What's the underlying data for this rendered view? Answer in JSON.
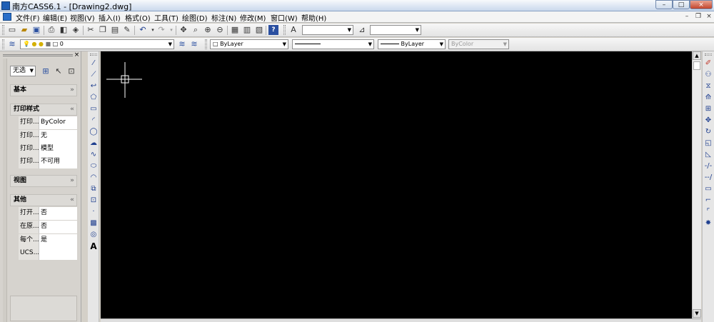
{
  "titlebar": {
    "app_title": "南方CASS6.1 - [Drawing2.dwg]",
    "min": "–",
    "max": "□",
    "close": "×"
  },
  "menubar": {
    "items": [
      "文件(F)",
      "编辑(E)",
      "视图(V)",
      "插入(I)",
      "格式(O)",
      "工具(T)",
      "绘图(D)",
      "标注(N)",
      "修改(M)",
      "窗口(W)",
      "帮助(H)"
    ],
    "mdi_min": "–",
    "mdi_restore": "❐",
    "mdi_close": "×"
  },
  "layer_toolbar": {
    "layer_value": "0",
    "color_value": "ByLayer",
    "linetype_value": "ByLayer",
    "lineweight_value": "",
    "plotstyle_value": "ByColor"
  },
  "palette": {
    "close": "×",
    "selection_value": "无选",
    "sections": {
      "basic": "基本",
      "plot_style": "打印样式",
      "view": "视图",
      "misc": "其他"
    },
    "plot_rows": [
      {
        "key": "打印...",
        "value": "ByColor"
      },
      {
        "key": "打印...",
        "value": "无"
      },
      {
        "key": "打印...",
        "value": "模型"
      },
      {
        "key": "打印...",
        "value": "不可用"
      }
    ],
    "misc_rows": [
      {
        "key": "打开...",
        "value": "否"
      },
      {
        "key": "在原...",
        "value": "否"
      },
      {
        "key": "每个...",
        "value": "是"
      },
      {
        "key": "UCS...",
        "value": ""
      }
    ]
  },
  "draw_tools": [
    "line",
    "construction-line",
    "polyline",
    "polygon",
    "rectangle",
    "arc",
    "circle",
    "revcloud",
    "spline",
    "ellipse",
    "ellipse-arc",
    "insert-block",
    "make-block",
    "point",
    "hatch",
    "region",
    "multiline-text"
  ],
  "draw_text_tool": "A",
  "modify_tools": [
    "erase",
    "copy",
    "mirror",
    "offset",
    "array",
    "move",
    "rotate",
    "scale",
    "stretch",
    "trim",
    "extend",
    "break",
    "chamfer",
    "fillet",
    "explode"
  ],
  "colors": {
    "canvas": "#000000",
    "crosshair": "#ffffff"
  }
}
